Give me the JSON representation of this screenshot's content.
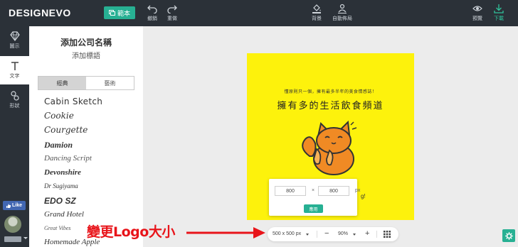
{
  "app": {
    "logo": "DESIGNEVO"
  },
  "topbar": {
    "template_label": "範本",
    "undo_label": "撤銷",
    "redo_label": "重做",
    "background_label": "背景",
    "auto_layout_label": "自動佈局",
    "preview_label": "預覽",
    "download_label": "下載"
  },
  "rail": {
    "icon_label": "圖示",
    "text_label": "文字",
    "shape_label": "形狀",
    "like_label": "Like"
  },
  "panel": {
    "title": "添加公司名稱",
    "subtitle": "添加標語",
    "tabs": [
      {
        "label": "經典",
        "active": true
      },
      {
        "label": "藝術",
        "active": false
      }
    ],
    "fonts": [
      "Cabin Sketch",
      "Cookie",
      "Courgette",
      "Damion",
      "Dancing Script",
      "Devonshire",
      "Dr Sugiyama",
      "EDO SZ",
      "Grand Hotel",
      "Great Vibes",
      "Homemade Apple"
    ]
  },
  "canvas": {
    "slogan": "懂原則只一個，擁有最多半年的美食情感誌！",
    "title": "擁有多的生活飲食頻道",
    "background_color": "#fdf20c",
    "partial_text": "g!"
  },
  "size_popup": {
    "width_value": "800",
    "height_value": "800",
    "times_symbol": "×",
    "unit": "px",
    "apply_label": "應用"
  },
  "zoombar": {
    "size_label": "500 x 500 px",
    "zoom_label": "90%",
    "minus": "−",
    "plus": "+"
  },
  "annotation": {
    "text": "變更Logo大小"
  },
  "colors": {
    "accent": "#27b093",
    "topbar": "#2b3138",
    "annotation": "#e8141a"
  }
}
